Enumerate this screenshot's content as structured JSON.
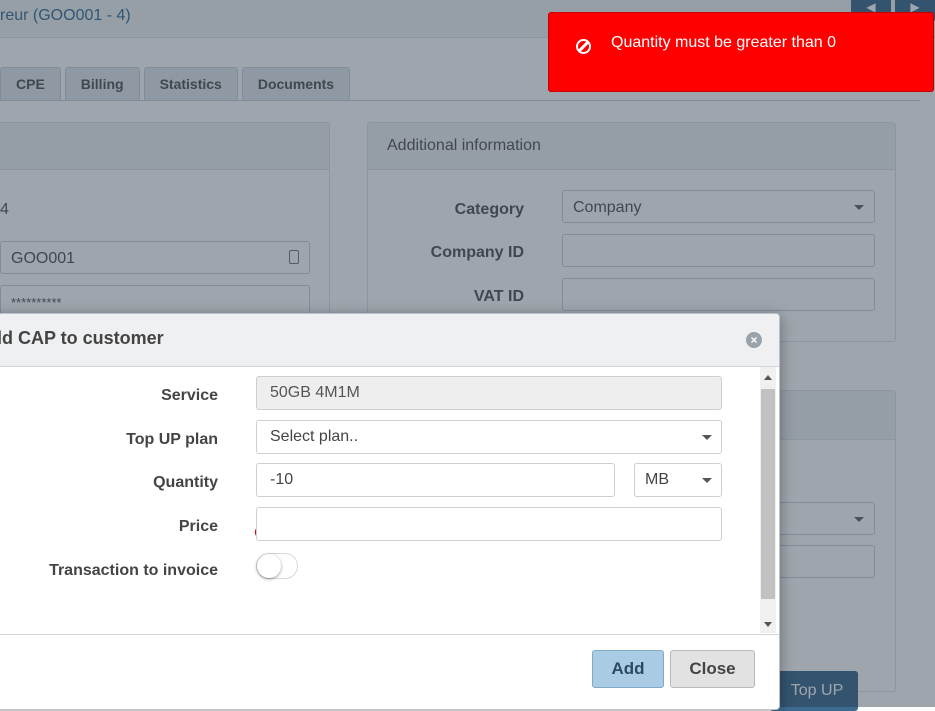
{
  "background": {
    "page_title": "reur (GOO001 - 4)",
    "tabs": [
      "CPE",
      "Billing",
      "Statistics",
      "Documents"
    ],
    "left_panel": {
      "id_value": "4",
      "login_value": "GOO001",
      "password_value": "**********"
    },
    "additional_info": {
      "title": "Additional information",
      "category_label": "Category",
      "category_value": "Company",
      "company_id_label": "Company ID",
      "vat_id_label": "VAT ID"
    },
    "top_up_button": "Top UP"
  },
  "toast": {
    "message": "Quantity must be greater than 0",
    "color": "#ff0000",
    "icon": "ban-icon"
  },
  "modal": {
    "title": "dd CAP to customer",
    "close_icon": "×",
    "fields": {
      "service_label": "Service",
      "service_value": "50GB 4M1M",
      "topup_label": "Top UP plan",
      "topup_value": "Select plan..",
      "quantity_label": "Quantity",
      "quantity_value": "-10",
      "unit_value": "MB",
      "price_label": "Price",
      "price_value": "",
      "transaction_label": "Transaction to invoice",
      "transaction_on": false
    },
    "buttons": {
      "add": "Add",
      "close": "Close"
    },
    "accent": "#a9cbe3"
  }
}
